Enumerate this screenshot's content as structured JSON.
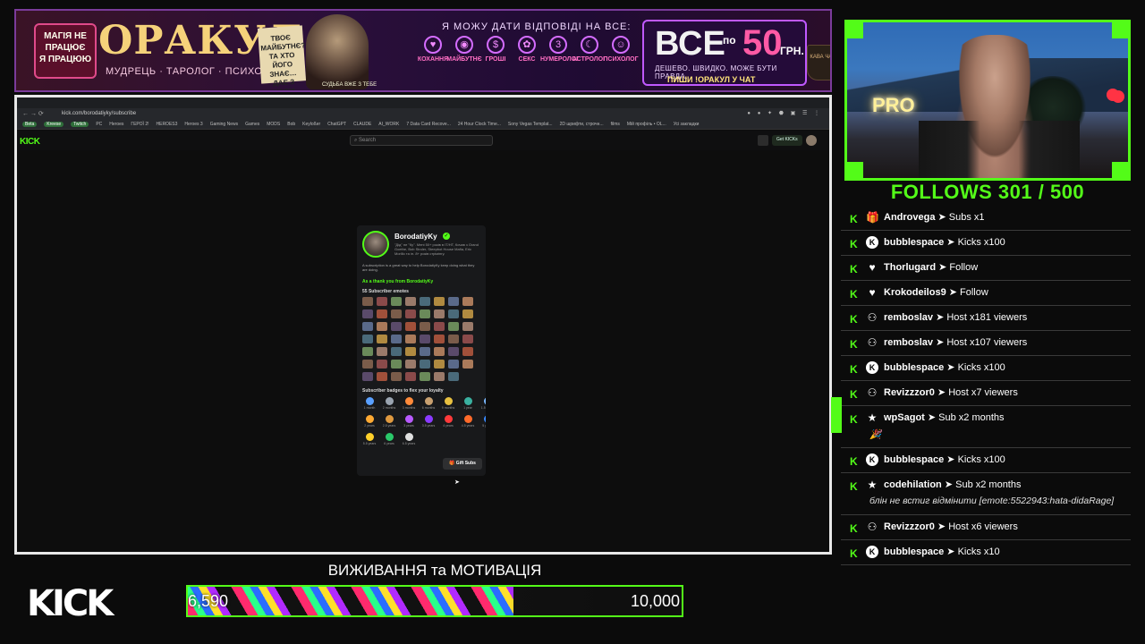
{
  "banner": {
    "magic_line1": "МАГІЯ НЕ",
    "magic_line2": "ПРАЦЮЄ",
    "magic_line3": "Я ПРАЦЮЮ",
    "title": "ОРАКУЛ",
    "subtitle": "МУДРЕЦЬ · ТАРОЛОГ · ПСИХОЛОГ",
    "card_text": "ТВОЄ МАЙБУТНЄ? ТА ХТО ЙОГО ЗНАЄ… ДАЕ З ЧАЄМ",
    "wizard_caption": "СУДЬБА ВЖЕ З ТЕБЕ",
    "answer_heading": "Я МОЖУ ДАТИ ВІДПОВІДІ НА ВСЕ:",
    "categories": [
      {
        "label": "КОХАННЯ",
        "icon": "heart-icon",
        "glyph": "♥"
      },
      {
        "label": "МАЙБУТНЄ",
        "icon": "crystal-ball-icon",
        "glyph": "◉"
      },
      {
        "label": "ГРОШІ",
        "icon": "money-icon",
        "glyph": "$"
      },
      {
        "label": "СЕКС",
        "icon": "apple-icon",
        "glyph": "✿"
      },
      {
        "label": "НУМЕРОЛОГ",
        "icon": "numbers-icon",
        "glyph": "3"
      },
      {
        "label": "АСТРОЛОГ",
        "icon": "moon-icon",
        "glyph": "☾"
      },
      {
        "label": "ПСИХОЛОГ",
        "icon": "head-icon",
        "glyph": "☺"
      }
    ],
    "price_word": "ВСЕ",
    "price_prefix": "по",
    "price_num": "50",
    "price_currency": "ГРН.",
    "price_line1": "ДЕШЕВО. ШВИДКО. МОЖЕ БУТИ ПРАВДА.",
    "price_line2": "ПИШИ !ОРАКУЛ У ЧАТ",
    "cup_text": "КАВА ЧАЙ"
  },
  "browser": {
    "nav_glyphs": "← → ⟳",
    "url": "kick.com/borodatiyky/subscribe",
    "toolbar_icons": "● ● ✦ ⬣ ▣ ☰ ⋮",
    "bookmarks": [
      {
        "label": "Beta",
        "pill": true
      },
      {
        "label": "Kreese",
        "pill": true
      },
      {
        "label": "Twitch",
        "pill": true
      },
      {
        "label": "PC",
        "pill": false
      },
      {
        "label": "Heroes",
        "pill": false
      },
      {
        "label": "ГЕРОЇ 2!",
        "pill": false
      },
      {
        "label": "HEROES3",
        "pill": false
      },
      {
        "label": "Heroes 3",
        "pill": false
      },
      {
        "label": "Gaming News",
        "pill": false
      },
      {
        "label": "Games",
        "pill": false
      },
      {
        "label": "MODS",
        "pill": false
      },
      {
        "label": "Bob",
        "pill": false
      },
      {
        "label": "Keyloßer",
        "pill": false
      },
      {
        "label": "ChatGPT",
        "pill": false
      },
      {
        "label": "CLAUDE",
        "pill": false
      },
      {
        "label": "AI_WORK",
        "pill": false
      },
      {
        "label": "7 Data Card Recove...",
        "pill": false
      },
      {
        "label": "24 Hour Clock Time...",
        "pill": false
      },
      {
        "label": "Sony Vegas Templat...",
        "pill": false
      },
      {
        "label": "2D шрифти, строчн...",
        "pill": false
      },
      {
        "label": "films",
        "pill": false
      },
      {
        "label": "Мій профіль • OL...",
        "pill": false
      },
      {
        "label": "Усі закладки",
        "pill": false
      }
    ],
    "kick_mini_logo": "KICK",
    "search_placeholder": "Search",
    "get_kicks": "Get KICKs"
  },
  "subscribe": {
    "name": "BorodatiyKy",
    "bio": "\"Дід\" не \"Ку\". Мені 50+ років в IT/HT, Кочав з Grand Goethe, Bob Stroler, Steepbot House Mafia, Eric Morillo та ін. 8+ років стрімінгу.",
    "description": "A subscription is a great way to help BorodatiyKy keep doing what they are doing.",
    "thanks": "As a thank you from BorodatiyKy",
    "emotes_heading": "55 Subscriber emotes",
    "badges_heading": "Subscriber badges to flex your loyalty",
    "badges": [
      {
        "label": "1 month",
        "color": "#5aa0ff"
      },
      {
        "label": "2 months",
        "color": "#9aa4b0"
      },
      {
        "label": "3 months",
        "color": "#ff8a3a"
      },
      {
        "label": "6 months",
        "color": "#c8a070"
      },
      {
        "label": "9 months",
        "color": "#e8c040"
      },
      {
        "label": "1 year",
        "color": "#3ab0a0"
      },
      {
        "label": "1.5 years",
        "color": "#7ab8ff"
      },
      {
        "label": "2 years",
        "color": "#ffaa33"
      },
      {
        "label": "2.5 years",
        "color": "#e09a40"
      },
      {
        "label": "3 years",
        "color": "#b85aff"
      },
      {
        "label": "3.5 years",
        "color": "#8a3aff"
      },
      {
        "label": "4 years",
        "color": "#ff3a3a"
      },
      {
        "label": "4.5 years",
        "color": "#ff6a2a"
      },
      {
        "label": "5 years",
        "color": "#3a8aff"
      },
      {
        "label": "5.5 years",
        "color": "#ffd02a"
      },
      {
        "label": "6 years",
        "color": "#2ac86a"
      },
      {
        "label": "6.5 years",
        "color": "#e0e0e0"
      }
    ],
    "gift_label": "🎁 Gift Subs"
  },
  "overlay": {
    "follows": "FOLLOWS 301 / 500",
    "events": [
      {
        "icon": "gift-icon",
        "glyph": "🎁",
        "round": false,
        "user": "Androvega",
        "action": " ➤ Subs x1",
        "extra": ""
      },
      {
        "icon": "kick-coin-icon",
        "glyph": "K",
        "round": true,
        "user": "bubblespace",
        "action": " ➤ Kicks x100",
        "extra": ""
      },
      {
        "icon": "heart-icon",
        "glyph": "♥",
        "round": false,
        "user": "Thorlugard",
        "action": " ➤ Follow",
        "extra": ""
      },
      {
        "icon": "heart-icon",
        "glyph": "♥",
        "round": false,
        "user": "Krokodeilos9",
        "action": " ➤ Follow",
        "extra": ""
      },
      {
        "icon": "host-icon",
        "glyph": "⚇",
        "round": false,
        "user": "remboslav",
        "action": " ➤ Host x181 viewers",
        "extra": ""
      },
      {
        "icon": "host-icon",
        "glyph": "⚇",
        "round": false,
        "user": "remboslav",
        "action": " ➤ Host x107 viewers",
        "extra": ""
      },
      {
        "icon": "kick-coin-icon",
        "glyph": "K",
        "round": true,
        "user": "bubblespace",
        "action": " ➤ Kicks x100",
        "extra": ""
      },
      {
        "icon": "host-icon",
        "glyph": "⚇",
        "round": false,
        "user": "Revizzzor0",
        "action": " ➤ Host x7 viewers",
        "extra": ""
      },
      {
        "icon": "star-icon",
        "glyph": "★",
        "round": false,
        "user": "wpSagot",
        "action": " ➤ Sub x2 months",
        "extra": "🎉"
      },
      {
        "icon": "kick-coin-icon",
        "glyph": "K",
        "round": true,
        "user": "bubblespace",
        "action": " ➤ Kicks x100",
        "extra": ""
      },
      {
        "icon": "star-icon",
        "glyph": "★",
        "round": false,
        "user": "codehilation",
        "action": " ➤ Sub x2 months",
        "extra": "блін не встиг відмінити [emote:5522943:hata-didaRage]"
      },
      {
        "icon": "host-icon",
        "glyph": "⚇",
        "round": false,
        "user": "Revizzzor0",
        "action": " ➤ Host x6 viewers",
        "extra": ""
      },
      {
        "icon": "kick-coin-icon",
        "glyph": "K",
        "round": true,
        "user": "bubblespace",
        "action": " ➤ Kicks x10",
        "extra": ""
      }
    ],
    "cam_sign": "PRO",
    "kick_logo": "KICK",
    "goal_title": "ВИЖИВАННЯ та МОТИВАЦІЯ",
    "goal_current_label": "6,590",
    "goal_max_label": "10,000",
    "goal_current": 6590,
    "goal_max": 10000
  },
  "colors": {
    "kick_green": "#53fc18",
    "banner_border": "#7a3b9a"
  }
}
